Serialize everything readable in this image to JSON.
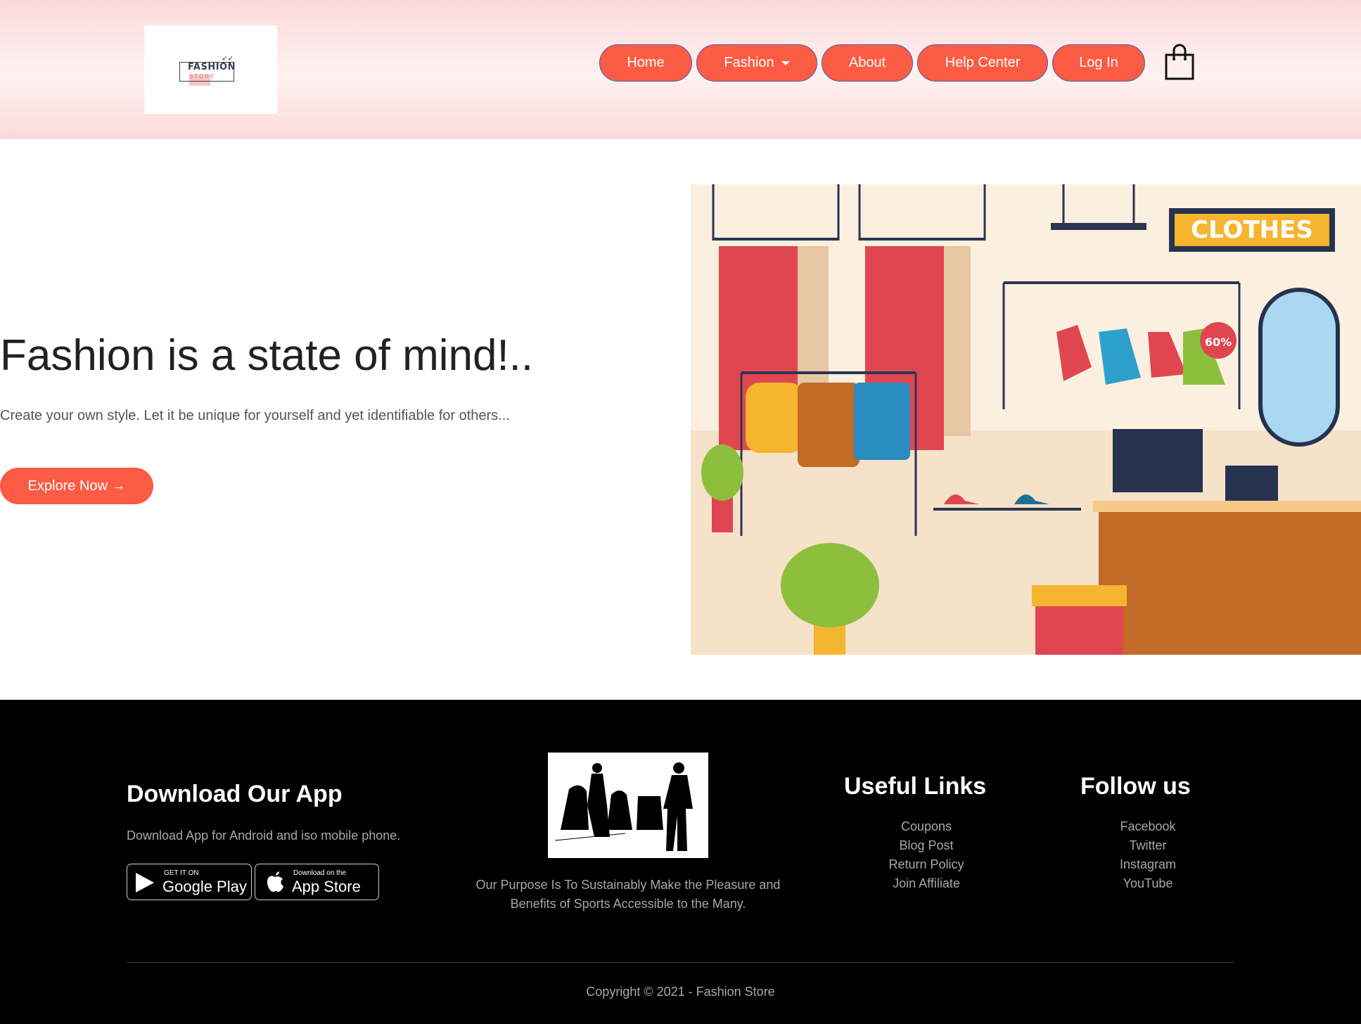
{
  "header": {
    "logo": {
      "title": "FASHION",
      "subtitle": "STORE"
    },
    "nav": {
      "home": "Home",
      "fashion": "Fashion",
      "about": "About",
      "help": "Help Center",
      "login": "Log In"
    },
    "cart_icon": "shopping-bag-icon"
  },
  "hero": {
    "title": "Fashion is a state of mind!..",
    "subtitle": "Create your own style. Let it be unique for yourself and yet identifiable for others...",
    "cta": "Explore Now →",
    "image_sign": "CLOTHES",
    "image_badge": "60%"
  },
  "footer": {
    "app": {
      "title": "Download Our App",
      "text": "Download App for Android and iso mobile phone.",
      "google_small": "GET IT ON",
      "google_big": "Google Play",
      "apple_small": "Download on the",
      "apple_big": "App Store"
    },
    "purpose": "Our Purpose Is To Sustainably Make the Pleasure and Benefits of Sports Accessible to the Many.",
    "useful_links": {
      "title": "Useful Links",
      "items": [
        "Coupons",
        "Blog Post",
        "Return Policy",
        "Join Affiliate"
      ]
    },
    "follow": {
      "title": "Follow us",
      "items": [
        "Facebook",
        "Twitter",
        "Instagram",
        "YouTube"
      ]
    },
    "copyright": "Copyright © 2021 - Fashion Store"
  },
  "colors": {
    "accent": "#fc5b44",
    "header_bg": "#fcd9da",
    "footer_bg": "#000000"
  }
}
